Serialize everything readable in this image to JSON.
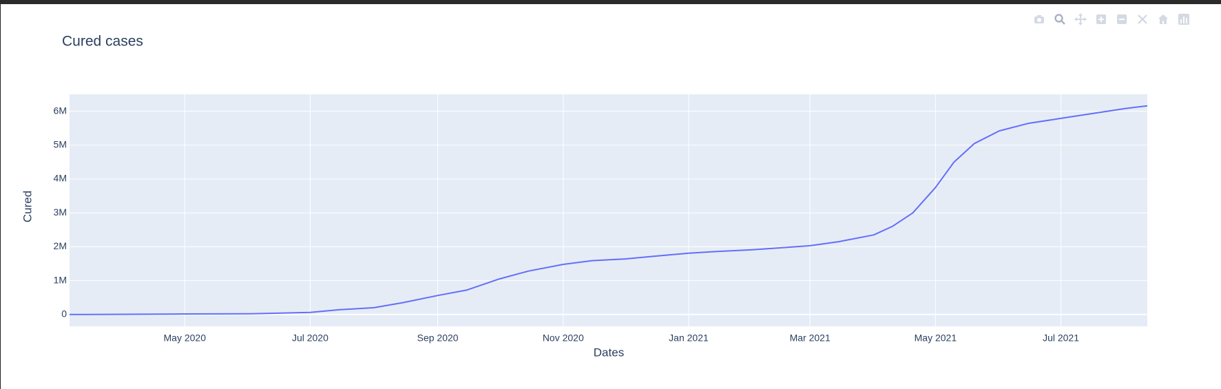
{
  "modebar": {
    "buttons": [
      {
        "icon": "camera-icon",
        "title": "Download plot as a png"
      },
      {
        "icon": "zoom-icon",
        "title": "Zoom"
      },
      {
        "icon": "pan-icon",
        "title": "Pan"
      },
      {
        "icon": "zoom-in-icon",
        "title": "Zoom in"
      },
      {
        "icon": "zoom-out-icon",
        "title": "Zoom out"
      },
      {
        "icon": "autoscale-icon",
        "title": "Autoscale"
      },
      {
        "icon": "reset-axes-icon",
        "title": "Reset axes"
      },
      {
        "icon": "plotly-logo-icon",
        "title": "Produced with Plotly"
      }
    ]
  },
  "chart_data": {
    "type": "line",
    "title": "Cured cases",
    "xlabel": "Dates",
    "ylabel": "Cured",
    "x_range": [
      "2020-03-06",
      "2021-08-12"
    ],
    "ylim": [
      -350000,
      6500000
    ],
    "x_ticks": [
      {
        "date": "2020-05-01",
        "label": "May 2020"
      },
      {
        "date": "2020-07-01",
        "label": "Jul 2020"
      },
      {
        "date": "2020-09-01",
        "label": "Sep 2020"
      },
      {
        "date": "2020-11-01",
        "label": "Nov 2020"
      },
      {
        "date": "2021-01-01",
        "label": "Jan 2021"
      },
      {
        "date": "2021-03-01",
        "label": "Mar 2021"
      },
      {
        "date": "2021-05-01",
        "label": "May 2021"
      },
      {
        "date": "2021-07-01",
        "label": "Jul 2021"
      }
    ],
    "y_ticks": [
      {
        "value": 0,
        "label": "0"
      },
      {
        "value": 1000000,
        "label": "1M"
      },
      {
        "value": 2000000,
        "label": "2M"
      },
      {
        "value": 3000000,
        "label": "3M"
      },
      {
        "value": 4000000,
        "label": "4M"
      },
      {
        "value": 5000000,
        "label": "5M"
      },
      {
        "value": 6000000,
        "label": "6M"
      }
    ],
    "grid": true,
    "colors": {
      "line": "#636efa",
      "plot_bg": "#e5ecf6",
      "grid": "#ffffff",
      "text": "#2a3f5f"
    },
    "series": [
      {
        "x": [
          "2020-03-06",
          "2020-04-01",
          "2020-05-01",
          "2020-06-01",
          "2020-07-01",
          "2020-07-15",
          "2020-08-01",
          "2020-08-15",
          "2020-09-01",
          "2020-09-15",
          "2020-10-01",
          "2020-10-15",
          "2020-11-01",
          "2020-11-15",
          "2020-12-01",
          "2020-12-15",
          "2021-01-01",
          "2021-01-15",
          "2021-02-01",
          "2021-02-15",
          "2021-03-01",
          "2021-03-15",
          "2021-04-01",
          "2021-04-10",
          "2021-04-20",
          "2021-05-01",
          "2021-05-10",
          "2021-05-20",
          "2021-06-01",
          "2021-06-15",
          "2021-07-01",
          "2021-07-15",
          "2021-08-01",
          "2021-08-12"
        ],
        "y": [
          0,
          5000,
          15000,
          20000,
          60000,
          140000,
          200000,
          350000,
          560000,
          720000,
          1050000,
          1280000,
          1480000,
          1590000,
          1640000,
          1720000,
          1810000,
          1860000,
          1910000,
          1970000,
          2030000,
          2150000,
          2350000,
          2600000,
          3000000,
          3750000,
          4500000,
          5050000,
          5420000,
          5640000,
          5790000,
          5920000,
          6080000,
          6160000
        ]
      }
    ]
  }
}
